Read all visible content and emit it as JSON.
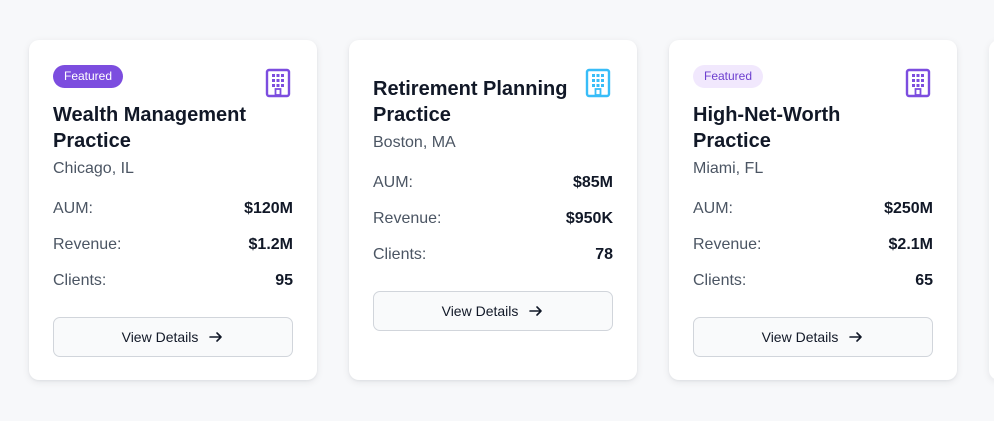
{
  "cards": [
    {
      "badge": "Featured",
      "badge_style": "solid",
      "icon": "building-icon",
      "icon_color": "#7c4ddf",
      "title": "Wealth Management Practice",
      "location": "Chicago, IL",
      "metrics": [
        {
          "label": "AUM:",
          "value": "$120M"
        },
        {
          "label": "Revenue:",
          "value": "$1.2M"
        },
        {
          "label": "Clients:",
          "value": "95"
        }
      ],
      "button_label": "View Details"
    },
    {
      "badge": "",
      "icon": "building-icon",
      "icon_color": "#38bdf8",
      "title": "Retirement Planning Practice",
      "location": "Boston, MA",
      "metrics": [
        {
          "label": "AUM:",
          "value": "$85M"
        },
        {
          "label": "Revenue:",
          "value": "$950K"
        },
        {
          "label": "Clients:",
          "value": "78"
        }
      ],
      "button_label": "View Details"
    },
    {
      "badge": "Featured",
      "badge_style": "soft",
      "icon": "building-icon",
      "icon_color": "#7c4ddf",
      "title": "High-Net-Worth Practice",
      "location": "Miami, FL",
      "metrics": [
        {
          "label": "AUM:",
          "value": "$250M"
        },
        {
          "label": "Revenue:",
          "value": "$2.1M"
        },
        {
          "label": "Clients:",
          "value": "65"
        }
      ],
      "button_label": "View Details"
    }
  ]
}
